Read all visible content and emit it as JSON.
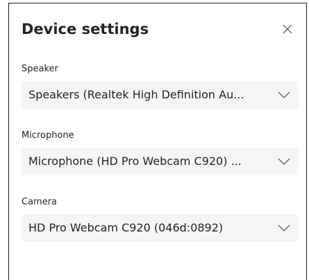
{
  "dialog": {
    "title": "Device settings",
    "close_icon": "close-icon"
  },
  "speaker": {
    "label": "Speaker",
    "selected": "Speakers (Realtek High Definition Au..."
  },
  "microphone": {
    "label": "Microphone",
    "selected": "Microphone (HD Pro Webcam C920) ..."
  },
  "camera": {
    "label": "Camera",
    "selected": "HD Pro Webcam C920 (046d:0892)"
  },
  "colors": {
    "select_background": "#f5f5f5",
    "text": "#242424",
    "border": "#1a1a1a"
  }
}
